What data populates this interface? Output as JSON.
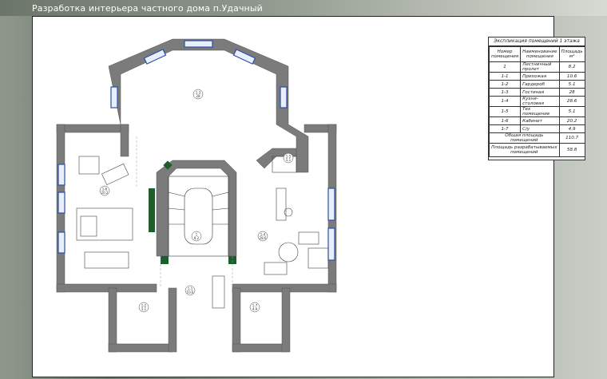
{
  "header": {
    "title": "Разработка интерьера частного дома п.Удачный"
  },
  "explication": {
    "title": "Экспликация помещений 1 этажа",
    "columns": [
      "Номер помещения",
      "Наименование помещения",
      "Площадь м²"
    ],
    "rows": [
      {
        "num": "1",
        "name": "Лестничный пролет",
        "area": "8.2"
      },
      {
        "num": "1-1",
        "name": "Прихожая",
        "area": "10.6"
      },
      {
        "num": "1-2",
        "name": "Гардероб",
        "area": "5.1"
      },
      {
        "num": "1-3",
        "name": "Гостиная",
        "area": "28"
      },
      {
        "num": "1-4",
        "name": "Кухня-столовая",
        "area": "28.6"
      },
      {
        "num": "1-5",
        "name": "Тех помещение",
        "area": "5.1"
      },
      {
        "num": "1-6",
        "name": "Кабинет",
        "area": "20.2"
      },
      {
        "num": "1-7",
        "name": "С/у",
        "area": "4.9"
      }
    ],
    "total_label": "Общая площадь помещений",
    "total_value": "110.7",
    "developed_label": "Площадь разрабатываемых помещений",
    "developed_value": "58.8"
  },
  "room_tags": [
    {
      "id": "1-6",
      "area": "20.2"
    },
    {
      "id": "1-3",
      "area": "28"
    },
    {
      "id": "1",
      "area": "8.2"
    },
    {
      "id": "1-4",
      "area": "28.6"
    },
    {
      "id": "1-5",
      "area": "5.1"
    },
    {
      "id": "1-1",
      "area": "10.6"
    },
    {
      "id": "1-2",
      "area": "5.1"
    },
    {
      "id": "1-7",
      "area": "4.9"
    }
  ],
  "colors": {
    "wall": "#7b7b7b",
    "window": "#2a4fa8",
    "door": "#1c5e2c"
  }
}
